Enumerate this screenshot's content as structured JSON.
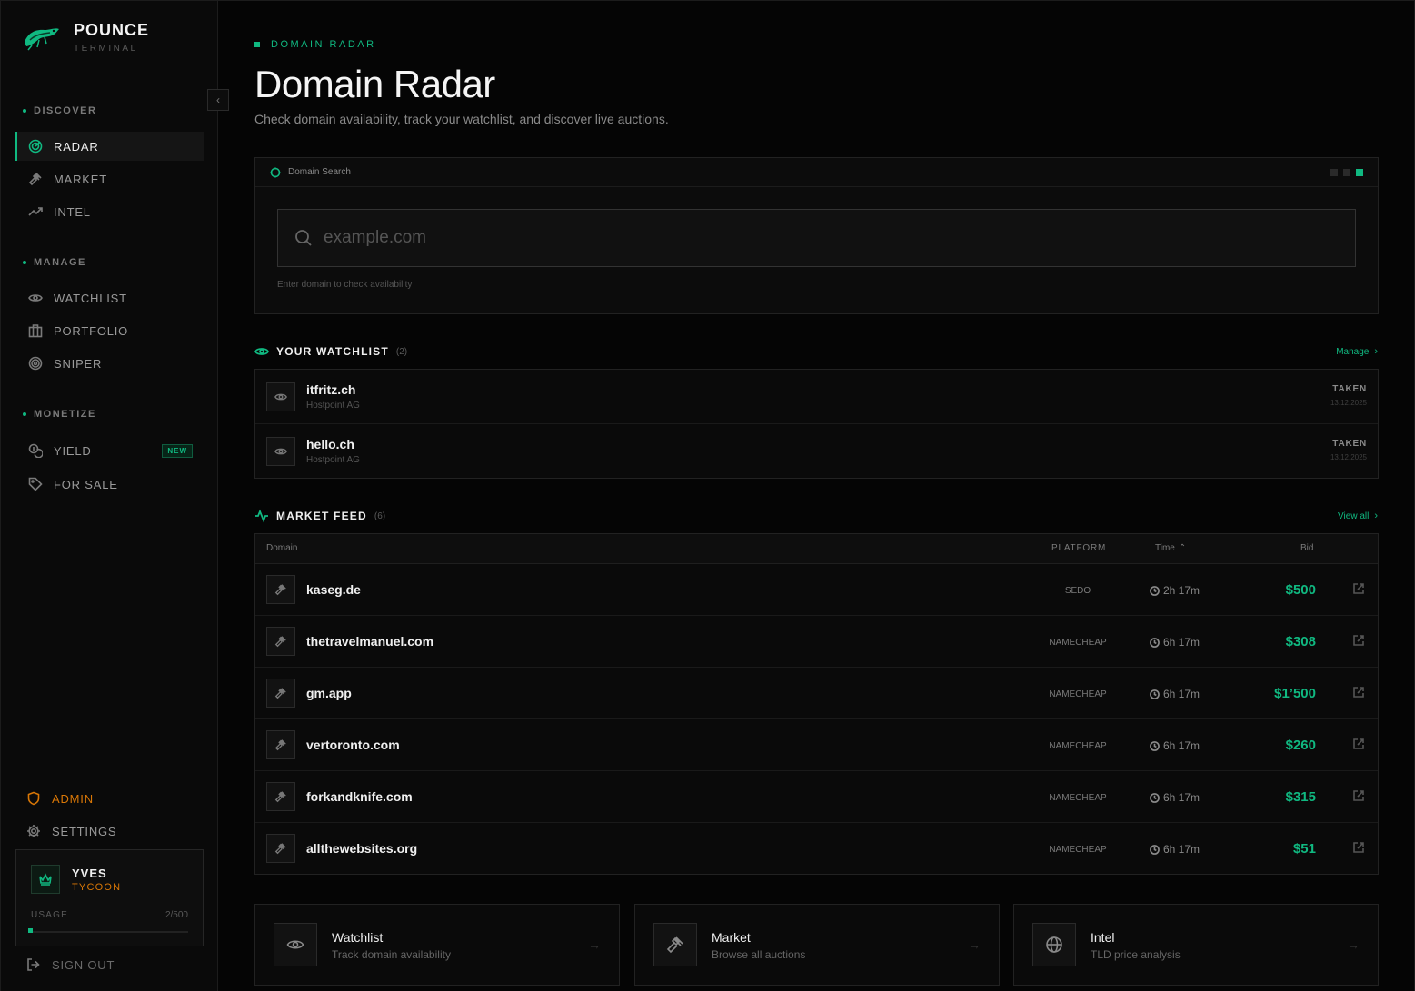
{
  "brand": {
    "name": "POUNCE",
    "sub": "TERMINAL"
  },
  "sidebar": {
    "sections": [
      {
        "title": "DISCOVER",
        "items": [
          {
            "label": "RADAR",
            "icon": "radar-icon",
            "active": true
          },
          {
            "label": "MARKET",
            "icon": "gavel-icon"
          },
          {
            "label": "INTEL",
            "icon": "trending-up-icon"
          }
        ]
      },
      {
        "title": "MANAGE",
        "items": [
          {
            "label": "WATCHLIST",
            "icon": "eye-icon"
          },
          {
            "label": "PORTFOLIO",
            "icon": "briefcase-icon"
          },
          {
            "label": "SNIPER",
            "icon": "target-icon"
          }
        ]
      },
      {
        "title": "MONETIZE",
        "items": [
          {
            "label": "YIELD",
            "icon": "coins-icon",
            "badge": "NEW"
          },
          {
            "label": "FOR SALE",
            "icon": "tag-icon"
          }
        ]
      }
    ],
    "admin_label": "ADMIN",
    "settings_label": "SETTINGS",
    "user": {
      "name": "YVES",
      "tier": "TYCOON",
      "usage_label": "USAGE",
      "usage_value": "2/500",
      "usage_fraction": 0.004
    },
    "signout_label": "SIGN OUT"
  },
  "header": {
    "crumb": "DOMAIN RADAR",
    "title": "Domain Radar",
    "subtitle": "Check domain availability, track your watchlist, and discover live auctions."
  },
  "search": {
    "panel_title": "Domain Search",
    "placeholder": "example.com",
    "value": "",
    "hint": "Enter domain to check availability"
  },
  "watchlist": {
    "title": "YOUR WATCHLIST",
    "count": "(2)",
    "link": "Manage",
    "items": [
      {
        "domain": "itfritz.ch",
        "registrar": "Hostpoint AG",
        "status": "TAKEN",
        "date": "13.12.2025"
      },
      {
        "domain": "hello.ch",
        "registrar": "Hostpoint AG",
        "status": "TAKEN",
        "date": "13.12.2025"
      }
    ]
  },
  "market_feed": {
    "title": "MARKET FEED",
    "count": "(6)",
    "link": "View all",
    "columns": {
      "domain": "Domain",
      "platform": "PLATFORM",
      "time": "Time",
      "bid": "Bid"
    },
    "rows": [
      {
        "domain": "kaseg.de",
        "platform": "SEDO",
        "time": "2h 17m",
        "bid": "$500"
      },
      {
        "domain": "thetravelmanuel.com",
        "platform": "NAMECHEAP",
        "time": "6h 17m",
        "bid": "$308"
      },
      {
        "domain": "gm.app",
        "platform": "NAMECHEAP",
        "time": "6h 17m",
        "bid": "$1’500"
      },
      {
        "domain": "vertoronto.com",
        "platform": "NAMECHEAP",
        "time": "6h 17m",
        "bid": "$260"
      },
      {
        "domain": "forkandknife.com",
        "platform": "NAMECHEAP",
        "time": "6h 17m",
        "bid": "$315"
      },
      {
        "domain": "allthewebsites.org",
        "platform": "NAMECHEAP",
        "time": "6h 17m",
        "bid": "$51"
      }
    ]
  },
  "quick_cards": [
    {
      "title": "Watchlist",
      "sub": "Track domain availability",
      "icon": "eye-icon"
    },
    {
      "title": "Market",
      "sub": "Browse all auctions",
      "icon": "gavel-icon"
    },
    {
      "title": "Intel",
      "sub": "TLD price analysis",
      "icon": "globe-icon"
    }
  ],
  "colors": {
    "accent": "#10b981",
    "admin": "#d97706",
    "background": "#050505"
  }
}
